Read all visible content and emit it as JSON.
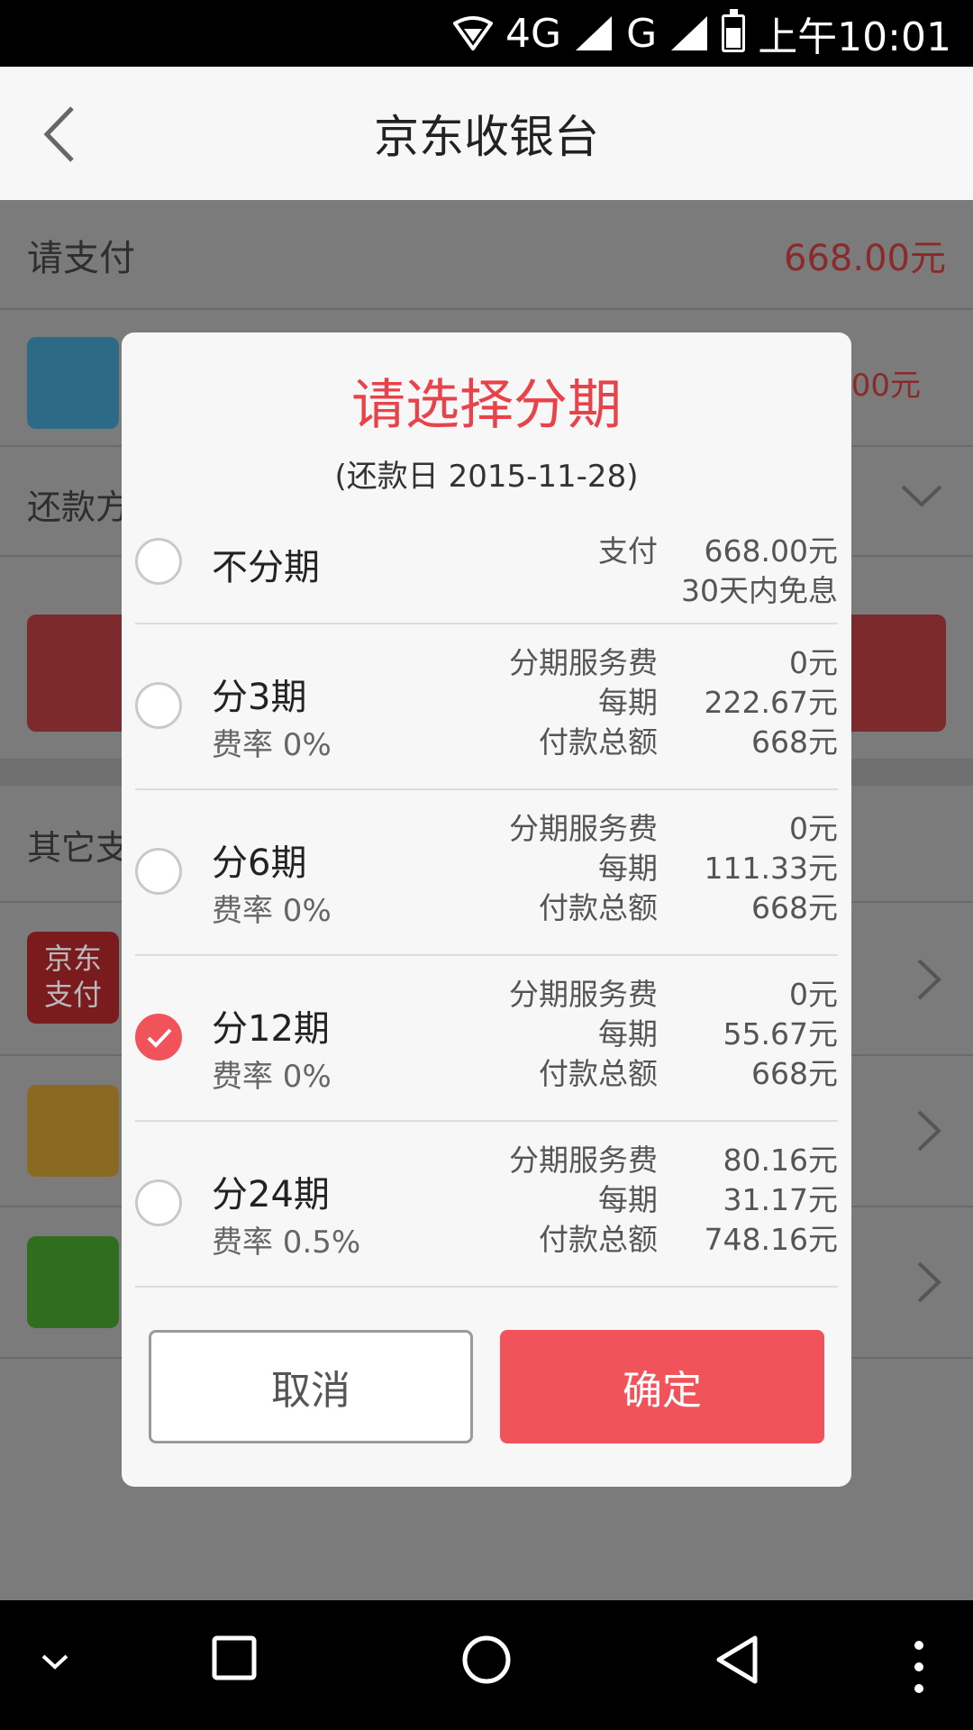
{
  "status_bar": {
    "network": "4G",
    "network2": "G",
    "time": "上午10:01"
  },
  "app_bar": {
    "title": "京东收银台"
  },
  "background": {
    "pay_label": "请支付",
    "pay_amount": "668.00元",
    "partial_amount": "00元",
    "repay_label": "还款方",
    "other_label": "其它支",
    "jd_pay_line1": "京东",
    "jd_pay_line2": "支付"
  },
  "modal": {
    "title": "请选择分期",
    "subtitle": "(还款日 2015-11-28)",
    "no_installment": {
      "label": "不分期",
      "pay_key": "支付",
      "pay_value": "668.00元",
      "note": "30天内免息"
    },
    "options": [
      {
        "label": "分3期",
        "rate": "费率 0%",
        "fee_key": "分期服务费",
        "fee": "0元",
        "per_key": "每期",
        "per": "222.67元",
        "total_key": "付款总额",
        "total": "668元",
        "selected": false
      },
      {
        "label": "分6期",
        "rate": "费率 0%",
        "fee_key": "分期服务费",
        "fee": "0元",
        "per_key": "每期",
        "per": "111.33元",
        "total_key": "付款总额",
        "total": "668元",
        "selected": false
      },
      {
        "label": "分12期",
        "rate": "费率 0%",
        "fee_key": "分期服务费",
        "fee": "0元",
        "per_key": "每期",
        "per": "55.67元",
        "total_key": "付款总额",
        "total": "668元",
        "selected": true
      },
      {
        "label": "分24期",
        "rate": "费率 0.5%",
        "fee_key": "分期服务费",
        "fee": "80.16元",
        "per_key": "每期",
        "per": "31.17元",
        "total_key": "付款总额",
        "total": "748.16元",
        "selected": false
      }
    ],
    "cancel": "取消",
    "confirm": "确定"
  },
  "colors": {
    "accent": "#f0535a",
    "title_red": "#e8434a"
  },
  "icons": [
    "back-arrow-icon",
    "wifi-icon",
    "signal-icon",
    "battery-icon",
    "chevron-down-icon",
    "chevron-right-icon",
    "checkmark-icon",
    "nav-back-icon",
    "nav-home-icon",
    "nav-recent-icon",
    "more-icon"
  ]
}
